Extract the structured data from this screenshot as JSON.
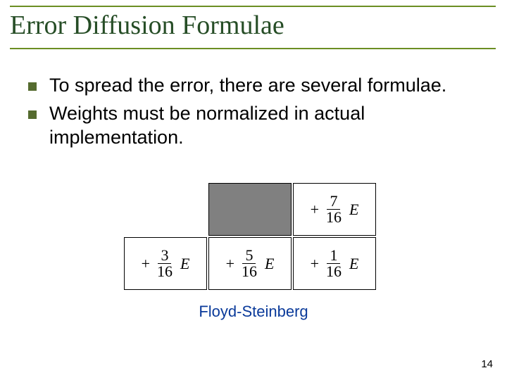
{
  "title": "Error Diffusion Formulae",
  "bullets": [
    "To spread the error, there are several formulae.",
    "Weights must be normalized in actual implementation."
  ],
  "kernel": {
    "top": [
      {
        "type": "shaded"
      },
      {
        "type": "weight",
        "num": "7",
        "den": "16"
      }
    ],
    "bottom": [
      {
        "type": "weight",
        "num": "3",
        "den": "16"
      },
      {
        "type": "weight",
        "num": "5",
        "den": "16"
      },
      {
        "type": "weight",
        "num": "1",
        "den": "16"
      }
    ]
  },
  "caption": "Floyd-Steinberg",
  "page_number": "14"
}
